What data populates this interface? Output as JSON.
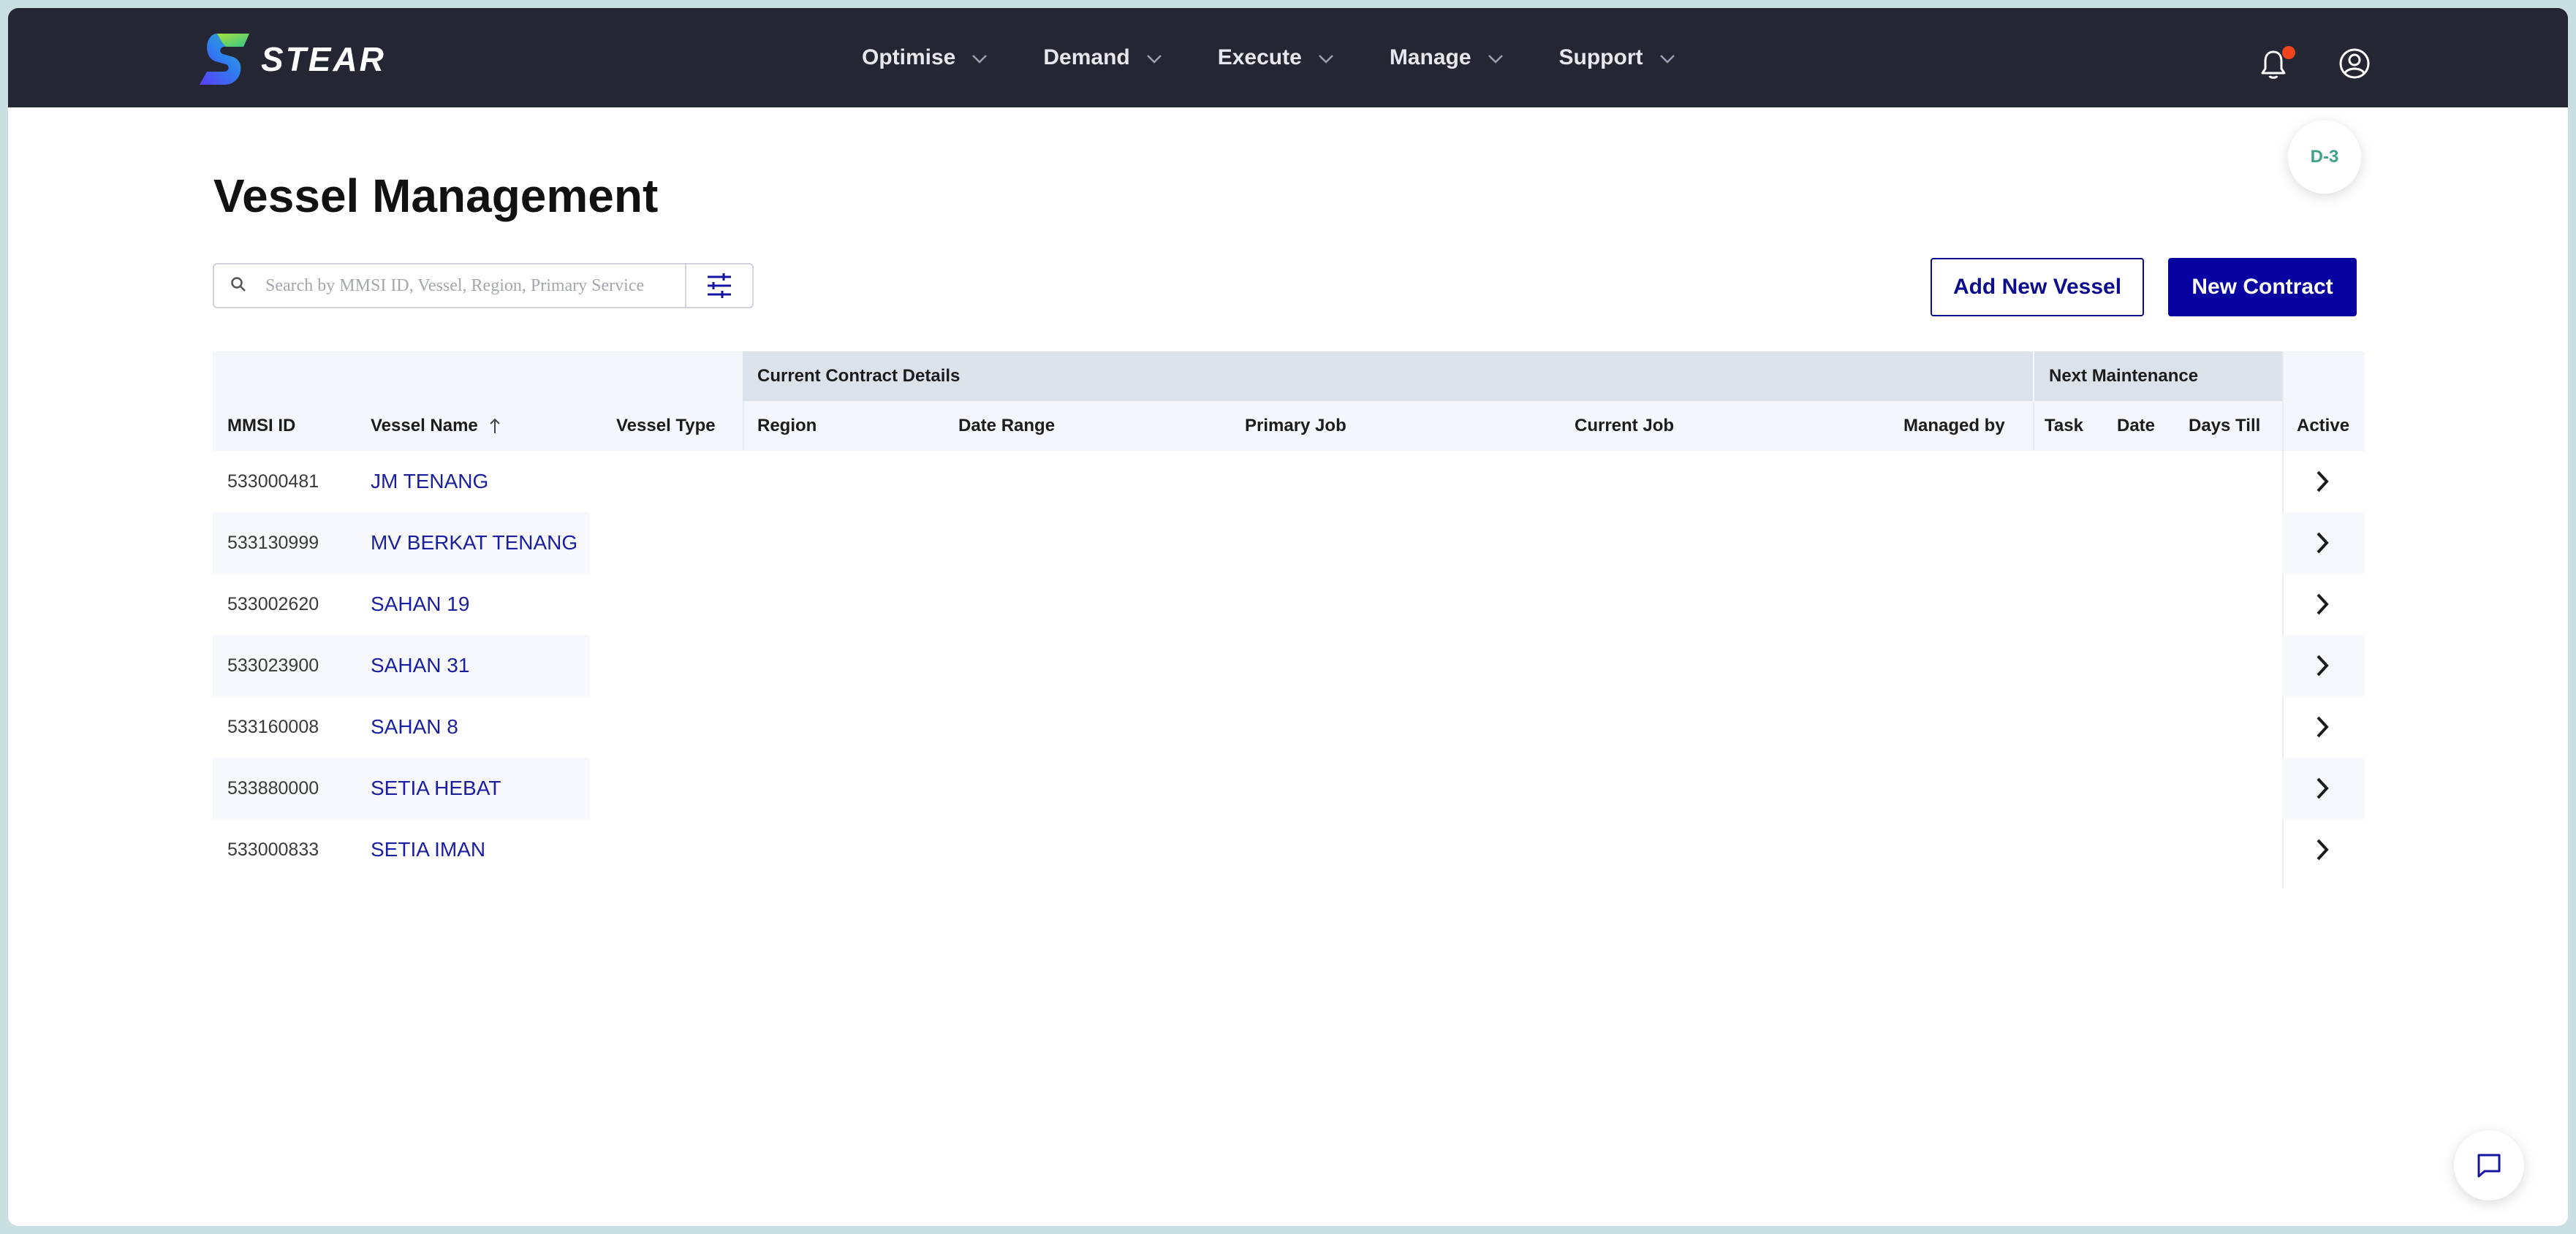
{
  "brand": {
    "name": "STEAR"
  },
  "nav": {
    "items": [
      {
        "label": "Optimise"
      },
      {
        "label": "Demand"
      },
      {
        "label": "Execute"
      },
      {
        "label": "Manage"
      },
      {
        "label": "Support"
      }
    ]
  },
  "header": {
    "env_badge": "D-3"
  },
  "page": {
    "title": "Vessel Management"
  },
  "search": {
    "placeholder": "Search by MMSI ID, Vessel, Region, Primary Service",
    "value": ""
  },
  "actions": {
    "add_vessel": "Add New Vessel",
    "new_contract": "New Contract"
  },
  "table": {
    "groups": {
      "current_contract": "Current Contract Details",
      "next_maintenance": "Next Maintenance"
    },
    "columns": {
      "mmsi": "MMSI ID",
      "vessel_name": "Vessel Name",
      "vessel_type": "Vessel Type",
      "region": "Region",
      "date_range": "Date Range",
      "primary_job": "Primary Job",
      "current_job": "Current Job",
      "managed_by": "Managed by",
      "task": "Task",
      "date": "Date",
      "days_till": "Days Till",
      "active": "Active"
    },
    "sort": {
      "column": "vessel_name",
      "direction": "asc"
    },
    "rows": [
      {
        "mmsi": "533000481",
        "name": "JM TENANG"
      },
      {
        "mmsi": "533130999",
        "name": "MV BERKAT TENANG"
      },
      {
        "mmsi": "533002620",
        "name": "SAHAN 19"
      },
      {
        "mmsi": "533023900",
        "name": "SAHAN 31"
      },
      {
        "mmsi": "533160008",
        "name": "SAHAN 8"
      },
      {
        "mmsi": "533880000",
        "name": "SETIA HEBAT"
      },
      {
        "mmsi": "533000833",
        "name": "SETIA IMAN"
      }
    ]
  },
  "colors": {
    "topbar": "#252634",
    "primary": "#0802a0",
    "link": "#1a1fa0",
    "notification": "#f0441e",
    "badge_text": "#3fa28b"
  }
}
